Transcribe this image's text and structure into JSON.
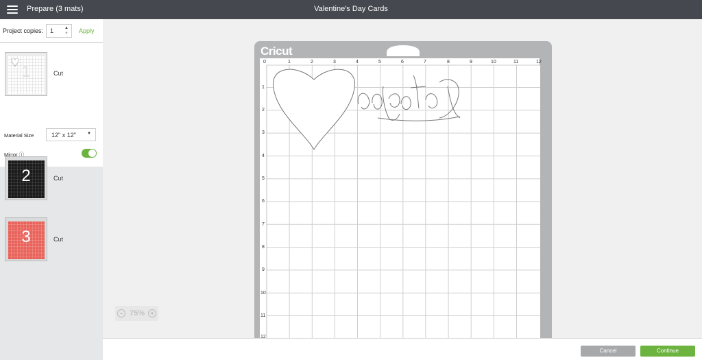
{
  "header": {
    "prepare_label": "Prepare (3 mats)",
    "project_title": "Valentine's Day Cards",
    "menu_icon": "hamburger-menu-icon"
  },
  "left_panel": {
    "project_copies_label": "Project copies:",
    "project_copies_value": "1",
    "apply_label": "Apply",
    "mats": [
      {
        "number": "1",
        "operation": "Cut",
        "color": "#ffffff",
        "selected": true
      },
      {
        "number": "2",
        "operation": "Cut",
        "color": "#1a1a1a",
        "selected": false
      },
      {
        "number": "3",
        "operation": "Cut",
        "color": "#e8625a",
        "selected": false
      }
    ],
    "material_size_label": "Material Size",
    "material_size_value": "12\" x 12\"",
    "mirror_label": "Mirror ⓘ",
    "mirror_on": true
  },
  "canvas": {
    "zoom": "75%",
    "mat_logo": "Cricut",
    "ruler_top": [
      "0",
      "1",
      "2",
      "3",
      "4",
      "5",
      "6",
      "7",
      "8",
      "9",
      "10",
      "11",
      "12"
    ],
    "ruler_left": [
      "1",
      "2",
      "3",
      "4",
      "5",
      "6",
      "7",
      "8",
      "9",
      "10",
      "11",
      "12"
    ]
  },
  "footer": {
    "cancel_label": "Cancel",
    "continue_label": "Continue"
  },
  "colors": {
    "accent_green": "#6cb33f",
    "header_bg": "#45484e",
    "mat_gray": "#b3b4b6"
  }
}
